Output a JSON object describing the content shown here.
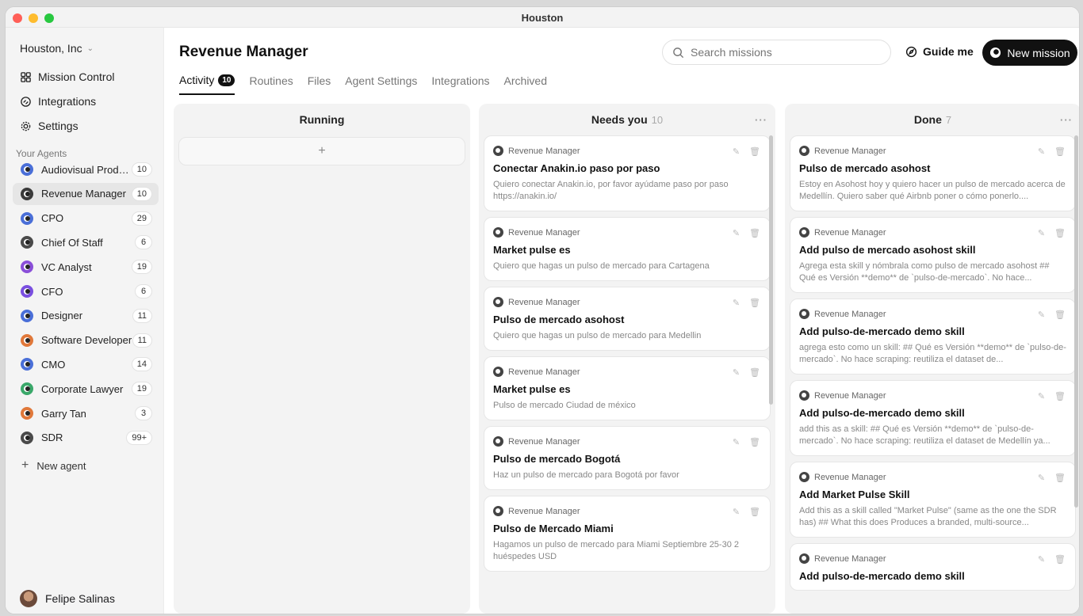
{
  "window": {
    "title": "Houston"
  },
  "sidebar": {
    "org": "Houston, Inc",
    "nav": [
      {
        "label": "Mission Control",
        "icon": "grid-icon"
      },
      {
        "label": "Integrations",
        "icon": "link-icon"
      },
      {
        "label": "Settings",
        "icon": "gear-icon"
      }
    ],
    "section_label": "Your Agents",
    "agents": [
      {
        "name": "Audiovisual Produ...",
        "count": "10",
        "color": "#4a6fd8"
      },
      {
        "name": "Revenue Manager",
        "count": "10",
        "color": "#3a3a3a"
      },
      {
        "name": "CPO",
        "count": "29",
        "color": "#4a6fd8"
      },
      {
        "name": "Chief Of Staff",
        "count": "6",
        "color": "#4a4a4a"
      },
      {
        "name": "VC Analyst",
        "count": "19",
        "color": "#8a4fd8"
      },
      {
        "name": "CFO",
        "count": "6",
        "color": "#7a4fe0"
      },
      {
        "name": "Designer",
        "count": "11",
        "color": "#4a6fd8"
      },
      {
        "name": "Software Developer",
        "count": "11",
        "color": "#e0783a"
      },
      {
        "name": "CMO",
        "count": "14",
        "color": "#4a6fd8"
      },
      {
        "name": "Corporate Lawyer",
        "count": "19",
        "color": "#3aa86a"
      },
      {
        "name": "Garry Tan",
        "count": "3",
        "color": "#e0783a"
      },
      {
        "name": "SDR",
        "count": "99+",
        "color": "#4a4a4a"
      }
    ],
    "new_agent": "New agent",
    "user": "Felipe Salinas"
  },
  "header": {
    "title": "Revenue Manager",
    "search_placeholder": "Search missions",
    "guide": "Guide me",
    "new_mission": "New mission"
  },
  "tabs": [
    {
      "label": "Activity",
      "badge": "10"
    },
    {
      "label": "Routines"
    },
    {
      "label": "Files"
    },
    {
      "label": "Agent Settings"
    },
    {
      "label": "Integrations"
    },
    {
      "label": "Archived"
    }
  ],
  "columns": {
    "running": {
      "title": "Running",
      "add": "+"
    },
    "needs_you": {
      "title": "Needs you",
      "count": "10",
      "more": "···",
      "cards": [
        {
          "agent": "Revenue Manager",
          "title": "Conectar Anakin.io paso por paso",
          "desc": "Quiero conectar Anakin.io, por favor ayúdame paso por paso https://anakin.io/"
        },
        {
          "agent": "Revenue Manager",
          "title": "Market pulse es",
          "desc": "Quiero que hagas un pulso de mercado para Cartagena"
        },
        {
          "agent": "Revenue Manager",
          "title": "Pulso de mercado asohost",
          "desc": "Quiero que hagas un pulso de mercado para Medellin"
        },
        {
          "agent": "Revenue Manager",
          "title": "Market pulse es",
          "desc": "Pulso de mercado Ciudad de méxico"
        },
        {
          "agent": "Revenue Manager",
          "title": "Pulso de mercado Bogotá",
          "desc": "Haz un pulso de mercado para Bogotá por favor"
        },
        {
          "agent": "Revenue Manager",
          "title": "Pulso de Mercado Miami",
          "desc": "Hagamos un pulso de mercado para Miami Septiembre 25-30 2 huéspedes USD"
        }
      ]
    },
    "done": {
      "title": "Done",
      "count": "7",
      "more": "···",
      "cards": [
        {
          "agent": "Revenue Manager",
          "title": "Pulso de mercado asohost",
          "desc": "Estoy en Asohost hoy y quiero hacer un pulso de mercado acerca de Medellín. Quiero saber qué Airbnb poner o cómo ponerlo...."
        },
        {
          "agent": "Revenue Manager",
          "title": "Add pulso de mercado asohost skill",
          "desc": "Agrega esta skill y nómbrala como pulso de mercado asohost ## Qué es Versión **demo** de `pulso-de-mercado`. No hace..."
        },
        {
          "agent": "Revenue Manager",
          "title": "Add pulso-de-mercado demo skill",
          "desc": "agrega esto como un skill: ## Qué es Versión **demo** de `pulso-de-mercado`. No hace scraping: reutiliza el dataset de..."
        },
        {
          "agent": "Revenue Manager",
          "title": "Add pulso-de-mercado demo skill",
          "desc": "add this as a skill: ## Qué es Versión **demo** de `pulso-de-mercado`. No hace scraping: reutiliza el dataset de Medellín ya..."
        },
        {
          "agent": "Revenue Manager",
          "title": "Add Market Pulse Skill",
          "desc": "Add this as a skill called \"Market Pulse\" (same as the one the SDR has) ## What this does Produces a branded, multi-source..."
        },
        {
          "agent": "Revenue Manager",
          "title": "Add pulso-de-mercado demo skill",
          "desc": ""
        }
      ]
    }
  }
}
